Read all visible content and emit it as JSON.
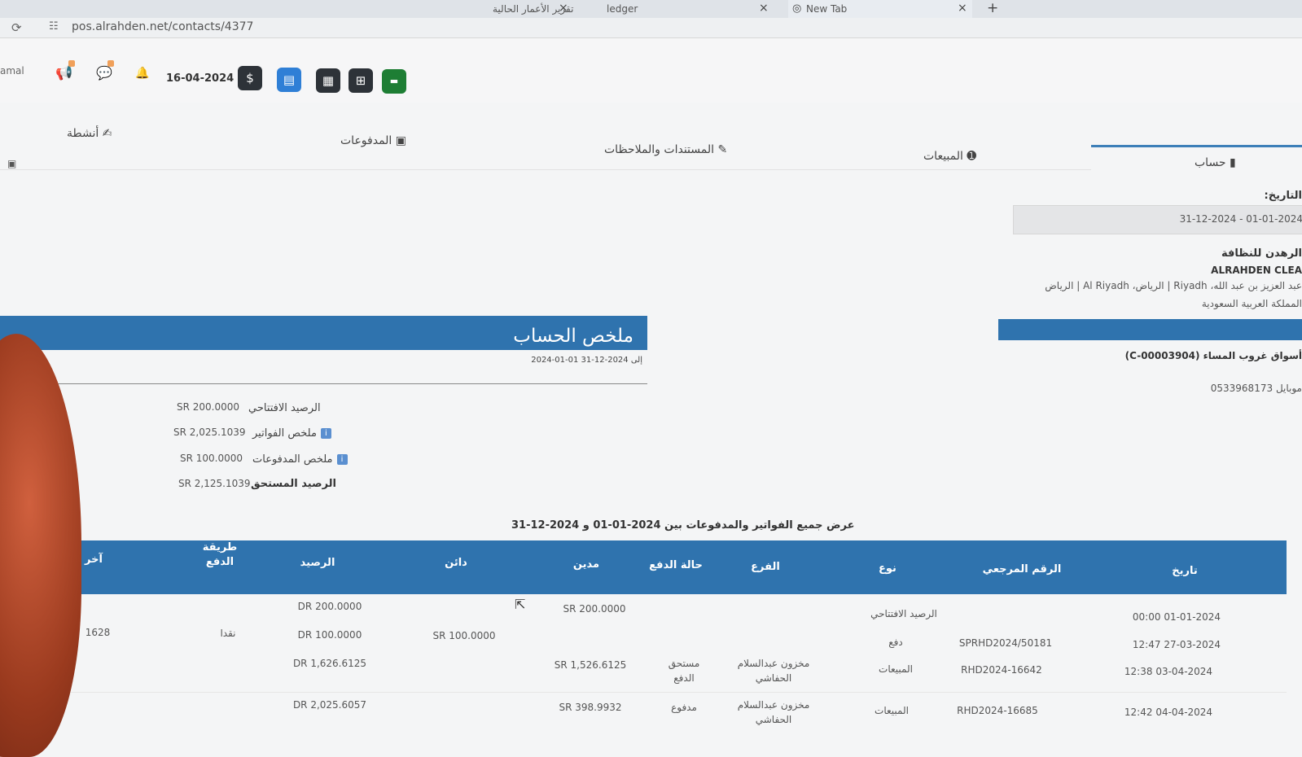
{
  "browser": {
    "tabs": [
      {
        "label": "تقرير الأعمار الحالية"
      },
      {
        "label": "ledger"
      },
      {
        "label": "New Tab"
      }
    ],
    "new_tab_symbol": "+",
    "close_symbol": "×",
    "url": "pos.alrahden.net/contacts/4377"
  },
  "header": {
    "user_fragment": "amal",
    "date": "16-04-2024"
  },
  "tabs": {
    "account": "حساب",
    "sales": "المبيعات",
    "documents": "المستندات والملاحظات",
    "payments": "المدفوعات",
    "activities": "أنشطة"
  },
  "right_panel": {
    "date_label": "التاريخ:",
    "date_range": "31-12-2024 - 01-01-2024",
    "company_ar": "الرهدن للنظافة",
    "company_en": "ALRAHDEN CLEA",
    "address_line1": "عبد العزيز بن عبد الله، Riyadh | الرياض، Al Riyadh | الرياض",
    "address_line2": "المملكة العربية السعودية",
    "customer": "أسواق غروب المساء (C-00003904)",
    "mobile_label": "موبايل",
    "mobile": "0533968173"
  },
  "summary": {
    "title": "ملخص الحساب",
    "range": "2024-01-01 إلى 2024-12-31",
    "rows": [
      {
        "label": "الرصيد الافتتاحي",
        "value": "SR 200.0000",
        "info": false,
        "bold": false
      },
      {
        "label": "ملخص الفواتير",
        "value": "SR 2,025.1039",
        "info": true,
        "bold": false
      },
      {
        "label": "ملخص المدفوعات",
        "value": "SR 100.0000",
        "info": true,
        "bold": false
      },
      {
        "label": "الرصيد المستحق",
        "value": "SR 2,125.1039",
        "info": false,
        "bold": true
      }
    ],
    "caption": "عرض جميع الفواتير والمدفوعات بين 2024-01-01 و 2024-12-31"
  },
  "table": {
    "headers": {
      "date": "تاريخ",
      "ref": "الرقم المرجعي",
      "type": "نوع",
      "branch": "الفرع",
      "pay_status": "حالة الدفع",
      "debit": "مدين",
      "credit": "دائن",
      "balance": "الرصيد",
      "pay_method": "طريقة الدفع",
      "other": "آخر"
    },
    "rows": [
      {
        "date": "01-01-2024 00:00",
        "ref": "",
        "type": "الرصيد الافتتاحي",
        "branch": "",
        "pay_status": "",
        "debit": "SR 200.0000",
        "credit": "",
        "balance": "DR 200.0000",
        "pay_method": "",
        "other": ""
      },
      {
        "date": "27-03-2024 12:47",
        "ref": "SPRHD2024/50181",
        "type": "دفع",
        "branch": "",
        "pay_status": "",
        "debit": "",
        "credit": "SR 100.0000",
        "balance": "DR 100.0000",
        "pay_method": "نقدا",
        "other": "1628"
      },
      {
        "date": "03-04-2024 12:38",
        "ref": "RHD2024-16642",
        "type": "المبيعات",
        "branch": "مخزون عبدالسلام الحفاشي",
        "pay_status": "مستحق الدفع",
        "debit": "SR 1,526.6125",
        "credit": "",
        "balance": "DR 1,626.6125",
        "pay_method": "",
        "other": ""
      },
      {
        "date": "04-04-2024 12:42",
        "ref": "RHD2024-16685",
        "type": "المبيعات",
        "branch": "مخزون عبدالسلام الحفاشي",
        "pay_status": "مدفوع",
        "debit": "SR 398.9932",
        "credit": "",
        "balance": "DR 2,025.6057",
        "pay_method": "",
        "other": ""
      }
    ]
  },
  "colors": {
    "accent_blue": "#2f73ae",
    "dark_button": "#2d3238",
    "blue_button": "#2f7fd6",
    "green_button": "#1e7e34"
  }
}
